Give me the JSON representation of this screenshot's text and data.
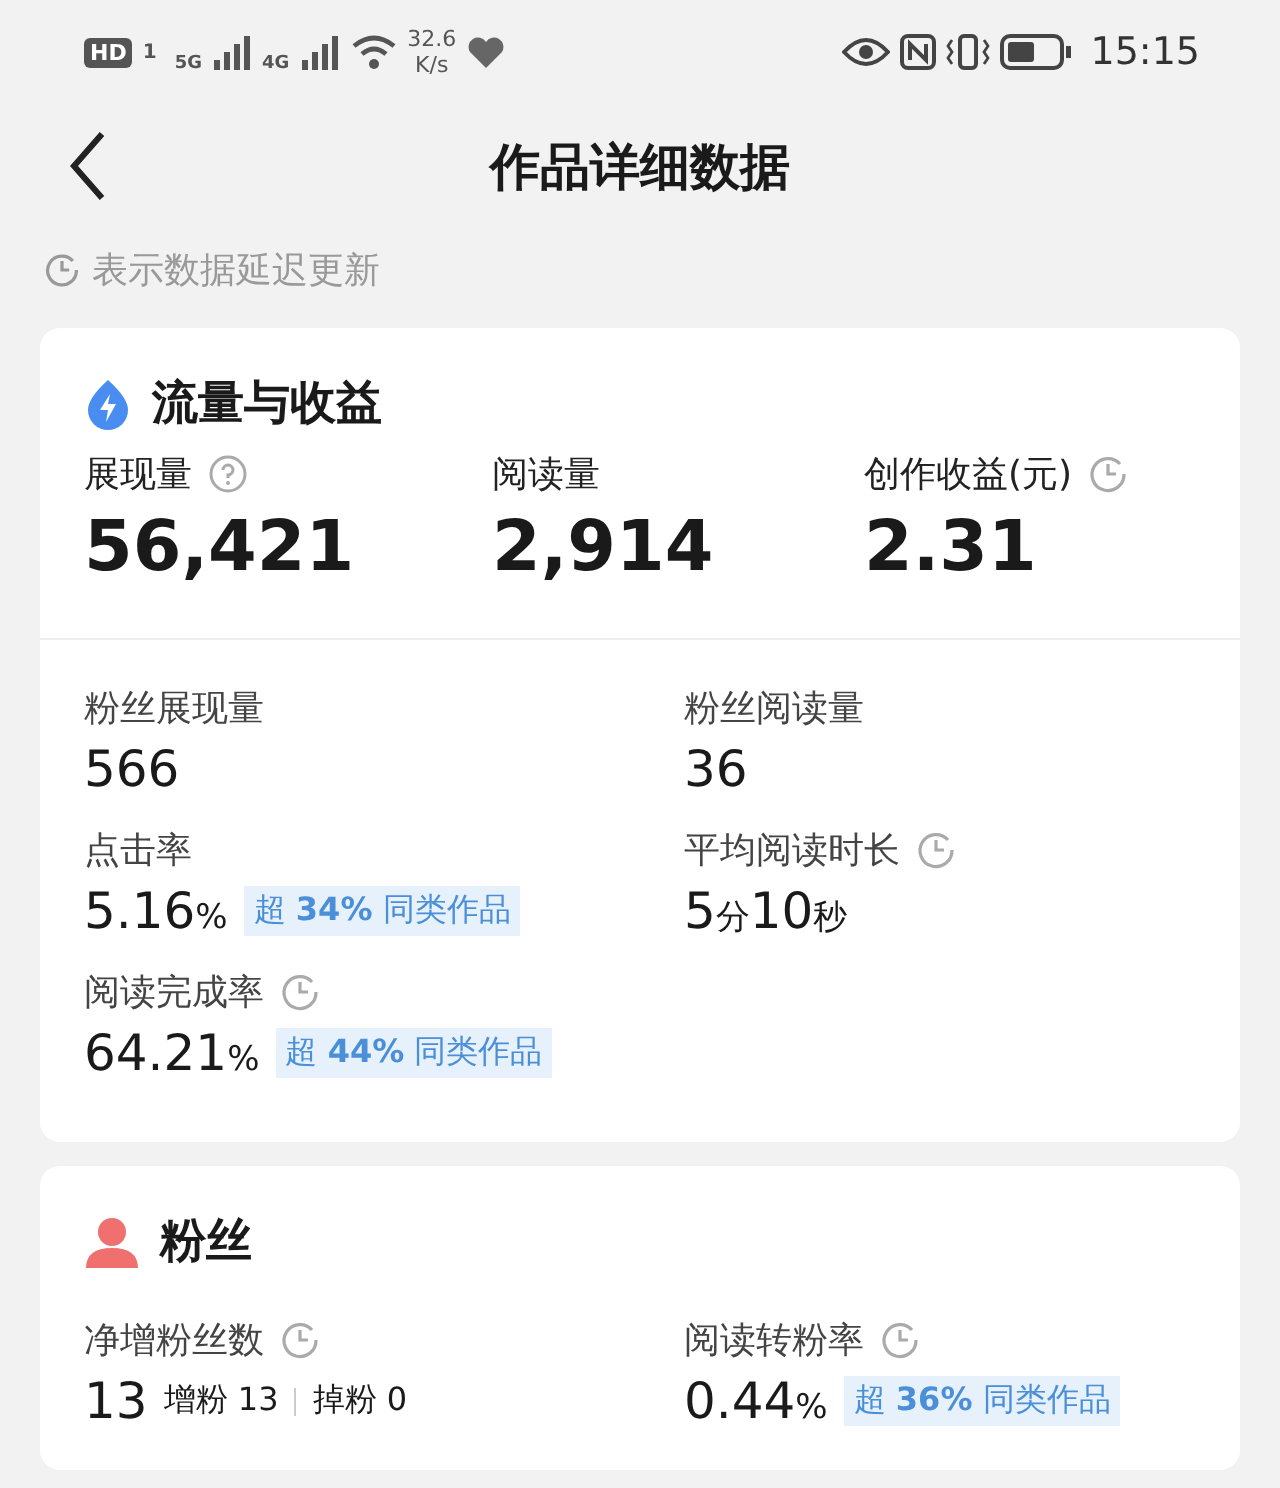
{
  "status_bar": {
    "hd": "HD",
    "sim": "1",
    "net_5g": "5G",
    "net_4g": "4G",
    "speed_value": "32.6",
    "speed_unit": "K/s",
    "time": "15:15"
  },
  "header": {
    "title": "作品详细数据"
  },
  "notice": {
    "text": "表示数据延迟更新"
  },
  "sections": [
    {
      "kind": "traffic",
      "title": "流量与收益",
      "top_stats": [
        {
          "label": "展现量",
          "kind": "help",
          "value": "56,421"
        },
        {
          "label": "阅读量",
          "kind": "plain",
          "value": "2,914"
        },
        {
          "label": "创作收益(元)",
          "kind": "delayed",
          "value": "2.31"
        }
      ],
      "metrics": [
        {
          "label": "粉丝展现量",
          "kind": "plain",
          "value": [
            {
              "text": "566",
              "kind": "num"
            }
          ]
        },
        {
          "label": "粉丝阅读量",
          "kind": "plain",
          "value": [
            {
              "text": "36",
              "kind": "num"
            }
          ]
        },
        {
          "label": "点击率",
          "kind": "plain",
          "value": [
            {
              "text": "5.16",
              "kind": "num"
            },
            {
              "text": "%",
              "kind": "unit"
            }
          ],
          "badge": "超 **34%** 同类作品"
        },
        {
          "label": "平均阅读时长",
          "kind": "delayed",
          "value": [
            {
              "text": "5",
              "kind": "num"
            },
            {
              "text": "分",
              "kind": "unit"
            },
            {
              "text": "10",
              "kind": "num"
            },
            {
              "text": "秒",
              "kind": "unit"
            }
          ]
        },
        {
          "label": "阅读完成率",
          "kind": "delayed",
          "value": [
            {
              "text": "64.21",
              "kind": "num"
            },
            {
              "text": "%",
              "kind": "unit"
            }
          ],
          "badge": "超 **44%** 同类作品"
        }
      ]
    },
    {
      "kind": "fans",
      "title": "粉丝",
      "metrics": [
        {
          "label": "净增粉丝数",
          "kind": "delayed",
          "value": [
            {
              "text": "13",
              "kind": "num"
            }
          ],
          "details": [
            "增粉 13",
            "掉粉 0"
          ]
        },
        {
          "label": "阅读转粉率",
          "kind": "delayed",
          "value": [
            {
              "text": "0.44",
              "kind": "num"
            },
            {
              "text": "%",
              "kind": "unit"
            }
          ],
          "badge": "超 **36%** 同类作品"
        }
      ]
    }
  ]
}
